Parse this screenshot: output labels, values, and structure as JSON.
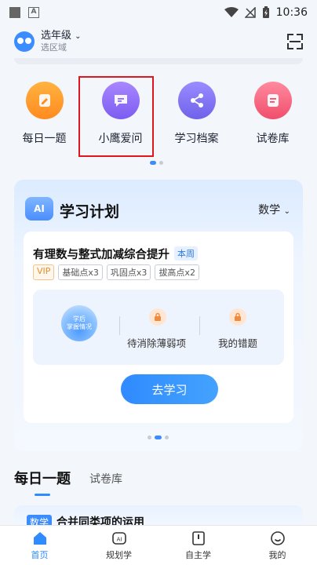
{
  "status": {
    "time": "10:36"
  },
  "header": {
    "grade": "选年级",
    "region": "选区域"
  },
  "quick": [
    {
      "label": "每日一题",
      "icon": "pencil-icon"
    },
    {
      "label": "小鹰爱问",
      "icon": "chat-icon"
    },
    {
      "label": "学习档案",
      "icon": "share-nodes-icon"
    },
    {
      "label": "试卷库",
      "icon": "document-icon"
    }
  ],
  "plan": {
    "badge": "AI",
    "title": "学习计划",
    "subject": "数学",
    "course": "有理数与整式加减综合提升",
    "week_tag": "本周",
    "tags": [
      "VIP",
      "基础点x3",
      "巩固点x3",
      "拔高点x2"
    ],
    "globe_text_1": "学后",
    "globe_text_2": "掌握情况",
    "stat1": "待消除薄弱项",
    "stat2": "我的错题",
    "cta": "去学习"
  },
  "daily": {
    "tab_active": "每日一题",
    "tab_other": "试卷库",
    "subject": "数学",
    "title": "合并同类项的运用"
  },
  "nav": [
    "首页",
    "规划学",
    "自主学",
    "我的"
  ],
  "colors": {
    "accent": "#2f8bff",
    "highlight": "#e0161e"
  }
}
